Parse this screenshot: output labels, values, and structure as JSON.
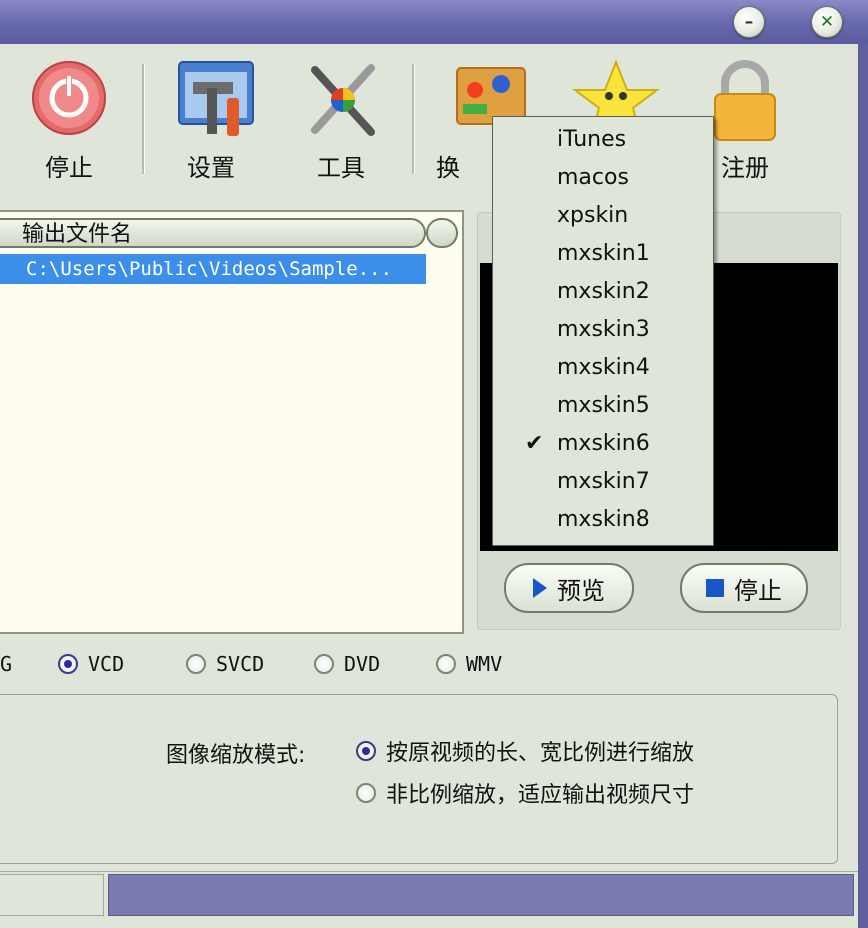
{
  "toolbar": {
    "stop_label": "停止",
    "settings_label": "设置",
    "tools_label": "工具",
    "skin_label": "换",
    "register_label": "注册"
  },
  "file_list": {
    "column_header": "输出文件名",
    "rows": [
      "C:\\Users\\Public\\Videos\\Sample..."
    ]
  },
  "preview": {
    "play_label": "预览",
    "stop_label": "停止"
  },
  "formats": {
    "partial_left": "G",
    "options": [
      {
        "label": "VCD",
        "selected": true
      },
      {
        "label": "SVCD",
        "selected": false
      },
      {
        "label": "DVD",
        "selected": false
      },
      {
        "label": "WMV",
        "selected": false
      }
    ]
  },
  "scaling": {
    "label": "图像缩放模式:",
    "option1": "按原视频的长、宽比例进行缩放",
    "option1_selected": true,
    "option2": "非比例缩放，适应输出视频尺寸",
    "option2_selected": false
  },
  "skin_menu": {
    "items": [
      "iTunes",
      "macos",
      "xpskin",
      "mxskin1",
      "mxskin2",
      "mxskin3",
      "mxskin4",
      "mxskin5",
      "mxskin6",
      "mxskin7",
      "mxskin8"
    ],
    "checked": "mxskin6"
  },
  "colors": {
    "frame": "#5f5f9e",
    "client_bg": "#dfe6d9",
    "selection": "#3c8fe8",
    "accent_blue": "#1a56c8"
  }
}
